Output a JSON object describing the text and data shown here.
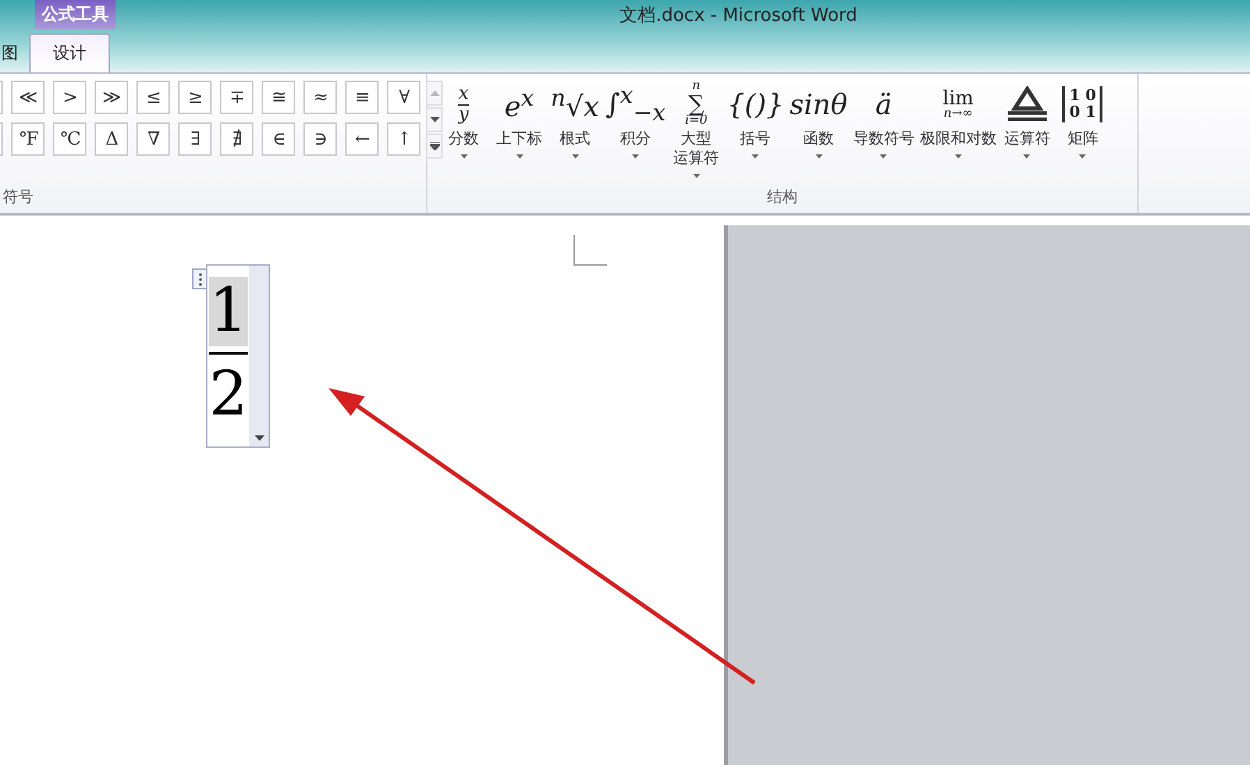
{
  "window": {
    "title": "文档.docx  -  Microsoft Word"
  },
  "context_tab_group": {
    "label": "公式工具"
  },
  "tabs": [
    {
      "label": "图",
      "selected": false
    },
    {
      "label": "设计",
      "selected": true
    }
  ],
  "symbols": {
    "label": "符号",
    "rows": [
      [
        "≪",
        ">",
        "≫",
        "≤",
        "≥",
        "∓",
        "≅",
        "≈",
        "≡",
        "∀"
      ],
      [
        "°F",
        "°C",
        "Δ",
        "∇",
        "∃",
        "∄",
        "∈",
        "∋",
        "←",
        "↑"
      ]
    ]
  },
  "structures": {
    "label": "结构",
    "items": [
      {
        "kind": "fraction",
        "glyph": [
          "x",
          "y"
        ],
        "label": [
          "分数"
        ]
      },
      {
        "kind": "inline",
        "glyph": [
          "e$^{x}$"
        ],
        "label": [
          "上下标"
        ]
      },
      {
        "kind": "inline",
        "glyph": [
          "$^{n}$√x"
        ],
        "label": [
          "根式"
        ]
      },
      {
        "kind": "inline",
        "glyph": [
          "∫$^{x}$$_{−x}$"
        ],
        "label": [
          "积分"
        ]
      },
      {
        "kind": "stack",
        "glyph": [
          "n",
          "∑",
          "i=0"
        ],
        "label": [
          "大型",
          "运算符"
        ]
      },
      {
        "kind": "inline",
        "glyph": [
          "{()}"
        ],
        "label": [
          "括号"
        ]
      },
      {
        "kind": "inline",
        "glyph": [
          "sinθ"
        ],
        "label": [
          "函数"
        ]
      },
      {
        "kind": "inline",
        "glyph": [
          "ä"
        ],
        "label": [
          "导数符号"
        ]
      },
      {
        "kind": "stack",
        "glyph": [
          "lim",
          "n→∞"
        ],
        "label": [
          "极限和对数"
        ]
      },
      {
        "kind": "operator",
        "label": [
          "运算符"
        ]
      },
      {
        "kind": "matrix",
        "glyph": [
          "1 0",
          "0 1"
        ],
        "label": [
          "矩阵"
        ]
      }
    ]
  },
  "equation": {
    "numerator": "1",
    "denominator": "2",
    "numerator_selected": true
  }
}
